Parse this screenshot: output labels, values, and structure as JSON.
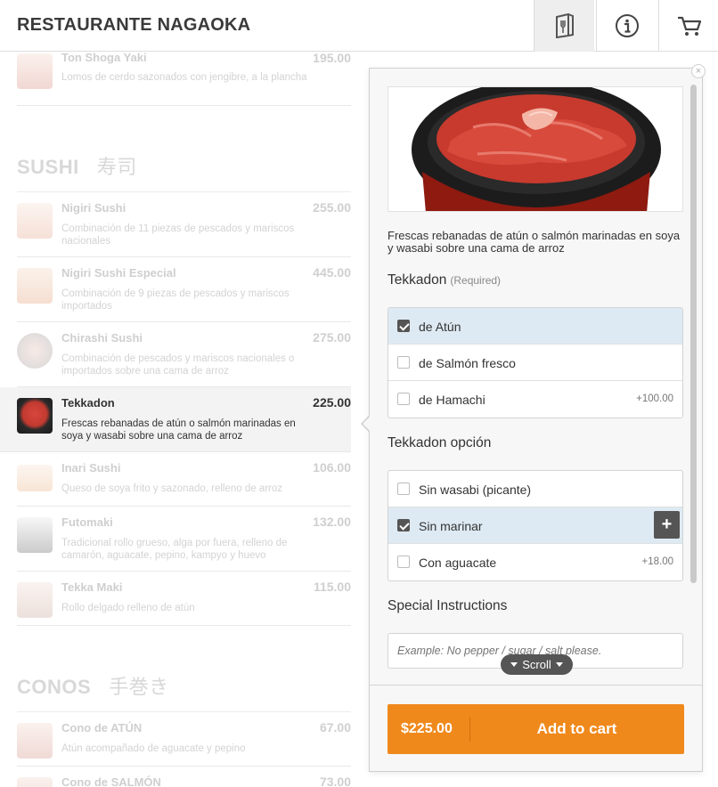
{
  "header": {
    "title": "RESTAURANTE NAGAOKA",
    "icons": [
      "menu-book-icon",
      "info-icon",
      "cart-icon"
    ]
  },
  "menu": {
    "top_item": {
      "name": "Ton Shoga Yaki",
      "price": "195.00",
      "desc": "Lomos de cerdo sazonados con jengibre, a la plancha"
    },
    "sections": [
      {
        "title": "SUSHI",
        "title_jp": "寿司",
        "items": [
          {
            "name": "Nigiri Sushi",
            "price": "255.00",
            "desc": "Combinación de 11 piezas de pescados y mariscos nacionales"
          },
          {
            "name": "Nigiri Sushi Especial",
            "price": "445.00",
            "desc": "Combinación de 9 piezas de pescados y mariscos importados"
          },
          {
            "name": "Chirashi Sushi",
            "price": "275.00",
            "desc": "Combinación de pescados y mariscos nacionales o importados sobre una cama de arroz"
          },
          {
            "name": "Tekkadon",
            "price": "225.00",
            "desc": "Frescas rebanadas de atún o salmón marinadas en soya y wasabi sobre una cama de arroz"
          },
          {
            "name": "Inari Sushi",
            "price": "106.00",
            "desc": "Queso de soya frito y sazonado, relleno de arroz"
          },
          {
            "name": "Futomaki",
            "price": "132.00",
            "desc": "Tradicional rollo grueso, alga por fuera, relleno de camarón, aguacate, pepino, kampyo y huevo"
          },
          {
            "name": "Tekka Maki",
            "price": "115.00",
            "desc": "Rollo delgado relleno de atún"
          }
        ]
      },
      {
        "title": "CONOS",
        "title_jp": "手巻き",
        "items": [
          {
            "name": "Cono de ATÚN",
            "price": "67.00",
            "desc": "Atún acompañado de aguacate y pepino"
          },
          {
            "name": "Cono de SALMÓN",
            "price": "73.00",
            "desc": ""
          }
        ]
      }
    ]
  },
  "panel": {
    "description": "Frescas rebanadas de atún o salmón marinadas en soya y wasabi sobre una cama de arroz",
    "group1": {
      "title": "Tekkadon",
      "required": "(Required)",
      "options": [
        {
          "label": "de Atún",
          "extra": "",
          "checked": true
        },
        {
          "label": "de Salmón fresco",
          "extra": "",
          "checked": false
        },
        {
          "label": "de Hamachi",
          "extra": "+100.00",
          "checked": false
        }
      ]
    },
    "group2": {
      "title": "Tekkadon opción",
      "options": [
        {
          "label": "Sin wasabi (picante)",
          "extra": "",
          "checked": false
        },
        {
          "label": "Sin marinar",
          "extra": "",
          "checked": true
        },
        {
          "label": "Con aguacate",
          "extra": "+18.00",
          "checked": false
        }
      ]
    },
    "instructions": {
      "title": "Special Instructions",
      "placeholder": "Example: No pepper / sugar / salt please."
    },
    "scroll_label": "Scroll",
    "plus_label": "+",
    "close_label": "×",
    "total": "$225.00",
    "add_to_cart": "Add to cart"
  },
  "colors": {
    "accent": "#f0891c",
    "selected_row": "#deeaf3",
    "dark_control": "#555555"
  }
}
